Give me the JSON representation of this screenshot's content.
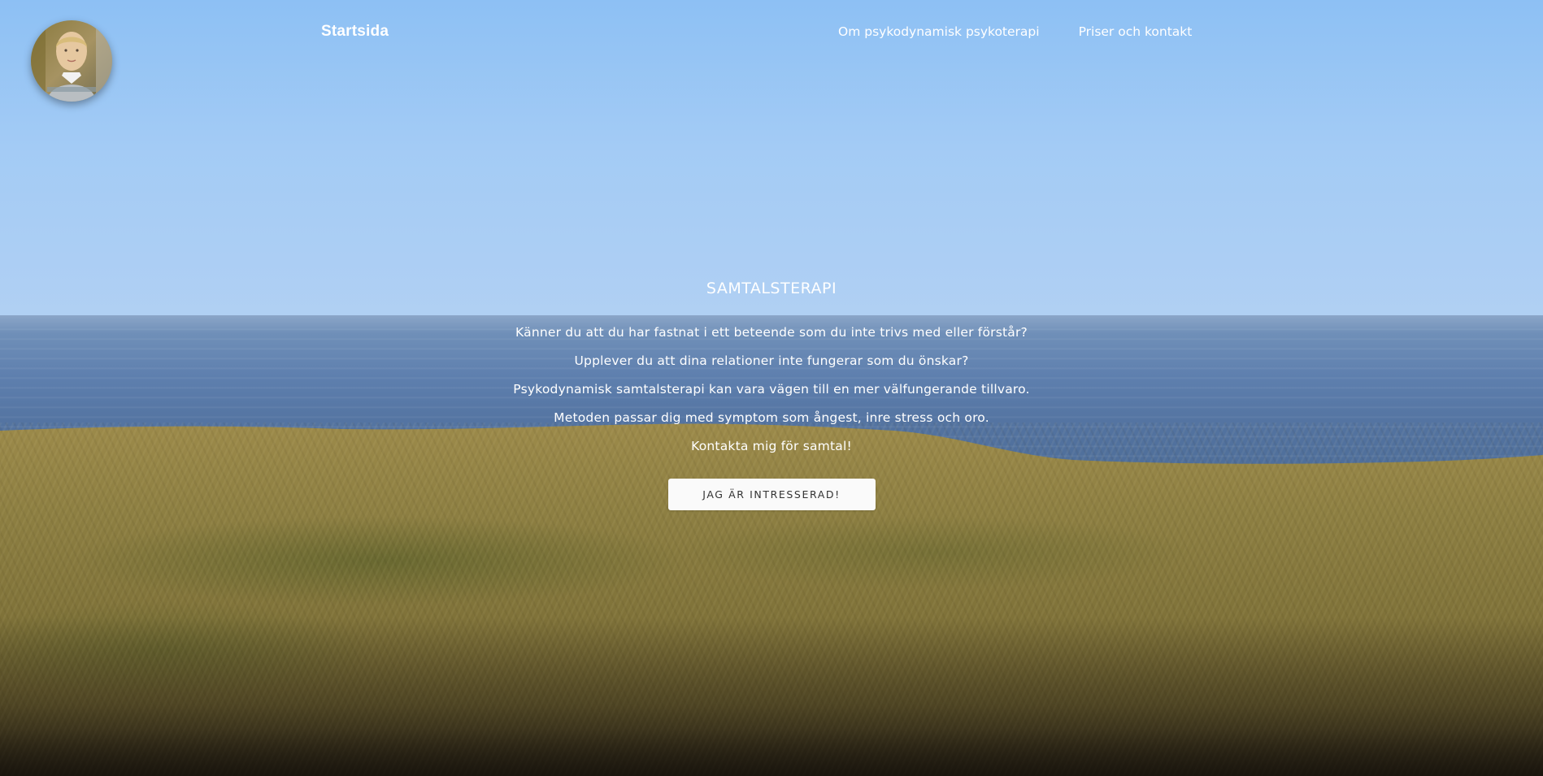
{
  "header": {
    "brand": "Startsida",
    "avatar_alt": "profile-photo",
    "nav": [
      {
        "label": "Om psykodynamisk psykoterapi"
      },
      {
        "label": "Priser och kontakt"
      }
    ]
  },
  "hero": {
    "title": "SAMTALSTERAPI",
    "lines": [
      "Känner du att du har fastnat i ett beteende som du inte trivs med eller förstår?",
      "Upplever du att dina relationer inte fungerar som du önskar?",
      "Psykodynamisk samtalsterapi kan vara vägen till en mer välfungerande tillvaro.",
      "Metoden passar dig med symptom som ångest, inre stress och oro.",
      "Kontakta mig för samtal!"
    ],
    "cta_label": "JAG ÄR INTRESSERAD!"
  },
  "colors": {
    "sky": "#8dc0f4",
    "sea": "#5e7fae",
    "grass": "#8a7d3e",
    "button_bg": "#fafafa",
    "button_text": "#333333"
  }
}
